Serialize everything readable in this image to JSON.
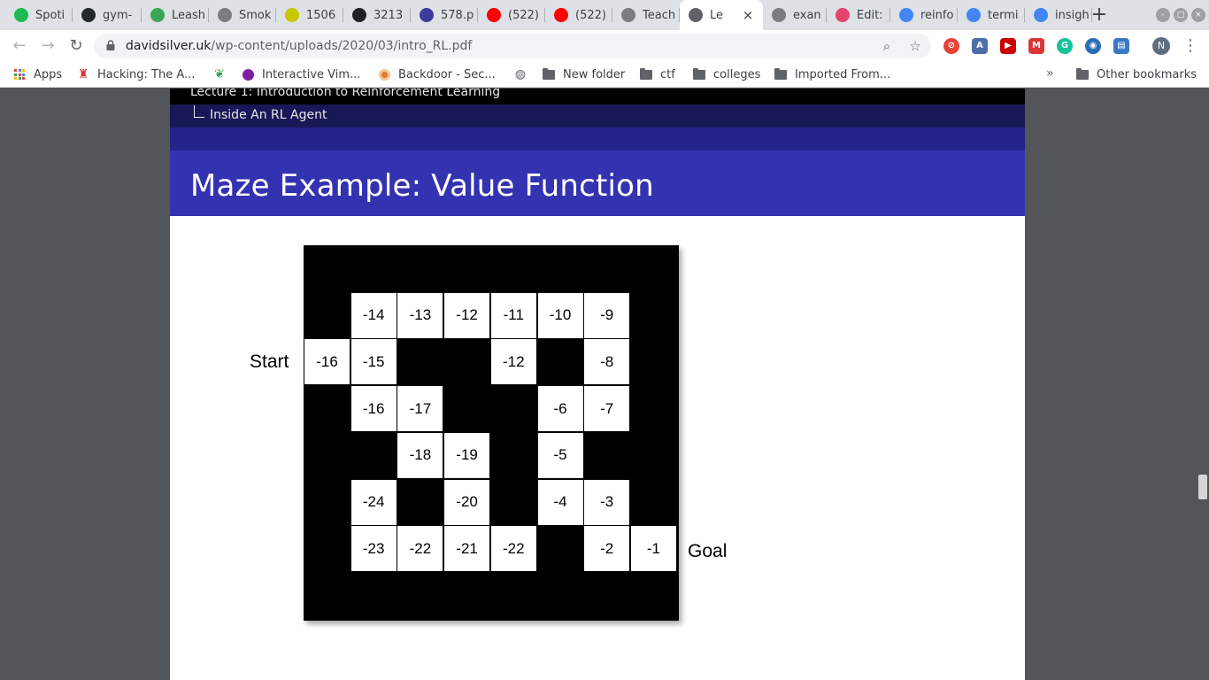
{
  "tabs": [
    {
      "title": "Spoti",
      "icon": "spotify-icon",
      "color": "#1db954"
    },
    {
      "title": "gym-",
      "icon": "github-icon",
      "color": "#24292e"
    },
    {
      "title": "Leash",
      "icon": "leaf-icon",
      "color": "#3aa757"
    },
    {
      "title": "Smok",
      "icon": "globe-icon",
      "color": "#7a7d82"
    },
    {
      "title": "1506",
      "icon": "smiley-icon",
      "color": "#c8c800"
    },
    {
      "title": "3213",
      "icon": "gear-icon",
      "color": "#202124"
    },
    {
      "title": "578.p",
      "icon": "globe-icon",
      "color": "#3c3c9c"
    },
    {
      "title": "(522)",
      "icon": "youtube-icon",
      "color": "#ff0000"
    },
    {
      "title": "(522)",
      "icon": "youtube-icon",
      "color": "#ff0000"
    },
    {
      "title": "Teach",
      "icon": "globe-icon",
      "color": "#7a7d82"
    },
    {
      "title": "Le",
      "icon": "globe-icon",
      "color": "#5f6368"
    },
    {
      "title": "exan",
      "icon": "globe-icon",
      "color": "#7a7d82"
    },
    {
      "title": "Edit:",
      "icon": "s-icon",
      "color": "#e2446c"
    },
    {
      "title": "reinfo",
      "icon": "google-icon",
      "color": "#4285f4"
    },
    {
      "title": "termi",
      "icon": "google-icon",
      "color": "#4285f4"
    },
    {
      "title": "insigh",
      "icon": "google-icon",
      "color": "#4285f4"
    }
  ],
  "active_tab_index": 10,
  "toolbar": {
    "url_host": "davidsilver.uk",
    "url_path": "/wp-content/uploads/2020/03/intro_RL.pdf",
    "profile_initial": "N"
  },
  "bookmarks": {
    "apps": "Apps",
    "items": [
      "Hacking: The A...",
      "",
      "Interactive Vim...",
      "Backdoor - Sec...",
      "",
      "New folder",
      "ctf",
      "colleges",
      "Imported From..."
    ],
    "other": "Other bookmarks"
  },
  "slide": {
    "lecture": "Lecture 1: Introduction to Reinforcement Learning",
    "section": "Inside An RL Agent",
    "title": "Maze Example: Value Function",
    "start_label": "Start",
    "goal_label": "Goal",
    "cells": [
      {
        "row": 1,
        "col": 1,
        "value": "-14"
      },
      {
        "row": 1,
        "col": 2,
        "value": "-13"
      },
      {
        "row": 1,
        "col": 3,
        "value": "-12"
      },
      {
        "row": 1,
        "col": 4,
        "value": "-11"
      },
      {
        "row": 1,
        "col": 5,
        "value": "-10"
      },
      {
        "row": 1,
        "col": 6,
        "value": "-9"
      },
      {
        "row": 2,
        "col": 0,
        "value": "-16"
      },
      {
        "row": 2,
        "col": 1,
        "value": "-15"
      },
      {
        "row": 2,
        "col": 4,
        "value": "-12"
      },
      {
        "row": 2,
        "col": 6,
        "value": "-8"
      },
      {
        "row": 3,
        "col": 1,
        "value": "-16"
      },
      {
        "row": 3,
        "col": 2,
        "value": "-17"
      },
      {
        "row": 3,
        "col": 5,
        "value": "-6"
      },
      {
        "row": 3,
        "col": 6,
        "value": "-7"
      },
      {
        "row": 4,
        "col": 2,
        "value": "-18"
      },
      {
        "row": 4,
        "col": 3,
        "value": "-19"
      },
      {
        "row": 4,
        "col": 5,
        "value": "-5"
      },
      {
        "row": 5,
        "col": 1,
        "value": "-24"
      },
      {
        "row": 5,
        "col": 3,
        "value": "-20"
      },
      {
        "row": 5,
        "col": 5,
        "value": "-4"
      },
      {
        "row": 5,
        "col": 6,
        "value": "-3"
      },
      {
        "row": 6,
        "col": 1,
        "value": "-23"
      },
      {
        "row": 6,
        "col": 2,
        "value": "-22"
      },
      {
        "row": 6,
        "col": 3,
        "value": "-21"
      },
      {
        "row": 6,
        "col": 4,
        "value": "-22"
      },
      {
        "row": 6,
        "col": 6,
        "value": "-2"
      },
      {
        "row": 6,
        "col": 7,
        "value": "-1"
      }
    ]
  }
}
